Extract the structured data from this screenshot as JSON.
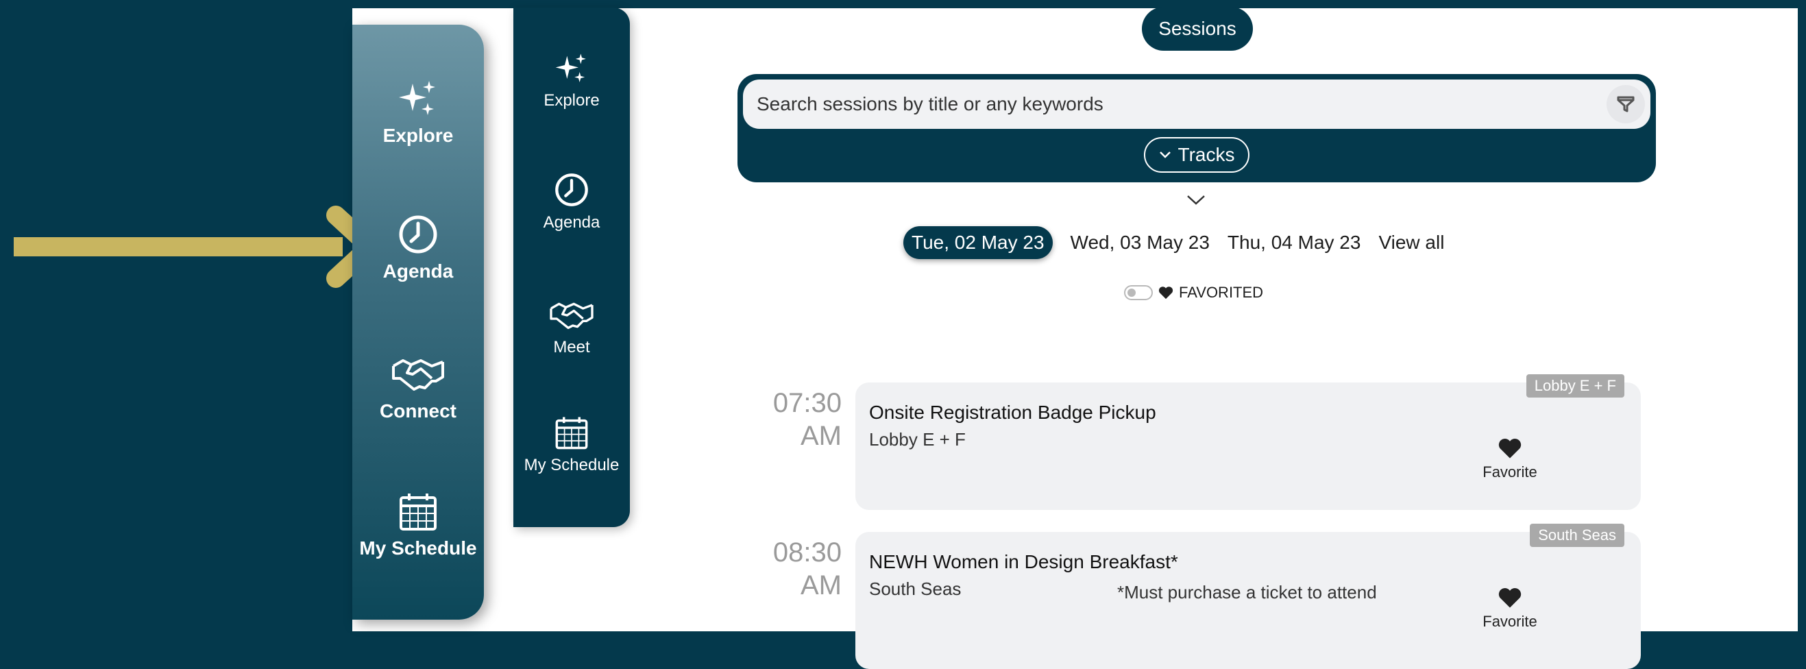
{
  "sidebar_large": {
    "items": [
      {
        "label": "Explore",
        "icon": "sparkles-icon"
      },
      {
        "label": "Agenda",
        "icon": "clock-icon"
      },
      {
        "label": "Connect",
        "icon": "handshake-icon"
      },
      {
        "label": "My Schedule",
        "icon": "calendar-icon"
      }
    ]
  },
  "sidebar_small": {
    "items": [
      {
        "label": "Explore",
        "icon": "sparkles-icon"
      },
      {
        "label": "Agenda",
        "icon": "clock-icon"
      },
      {
        "label": "Meet",
        "icon": "handshake-icon"
      },
      {
        "label": "My Schedule",
        "icon": "calendar-icon"
      }
    ]
  },
  "header": {
    "title": "Sessions"
  },
  "search": {
    "placeholder": "Search sessions by title or any keywords",
    "tracks_label": "Tracks"
  },
  "dates": {
    "items": [
      "Tue, 02 May 23",
      "Wed, 03 May 23",
      "Thu, 04 May 23",
      "View all"
    ],
    "selected": "Tue, 02 May 23"
  },
  "favorited_toggle": {
    "label": "FAVORITED"
  },
  "sessions": [
    {
      "time": "07:30",
      "ampm": "AM",
      "title": "Onsite Registration Badge Pickup",
      "location": "Lobby E + F",
      "tag": "Lobby E + F",
      "note": "",
      "favorite_label": "Favorite"
    },
    {
      "time": "08:30",
      "ampm": "AM",
      "title": "NEWH Women in Design Breakfast*",
      "location": "South Seas",
      "tag": "South Seas",
      "note": "*Must purchase a ticket to attend",
      "favorite_label": "Favorite"
    }
  ],
  "colors": {
    "brand": "#04394c",
    "arrow": "#c8b560",
    "tag": "#a9a9a9",
    "card": "#f0f1f3"
  }
}
